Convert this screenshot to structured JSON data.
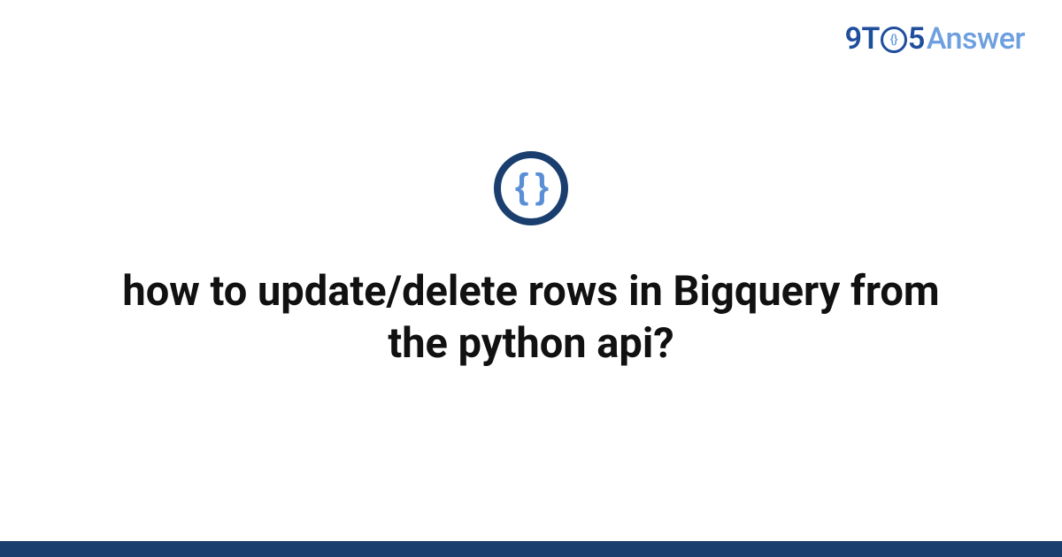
{
  "logo": {
    "nine": "9",
    "t": "T",
    "o_inner": "{}",
    "five": "5",
    "answer": "Answer"
  },
  "icon": {
    "braces": "{ }"
  },
  "title": "how to update/delete rows in Bigquery from the python api?",
  "colors": {
    "brand_dark": "#1a3e6e",
    "brand_blue": "#1f4e9c",
    "brand_light": "#6ea0e0"
  }
}
